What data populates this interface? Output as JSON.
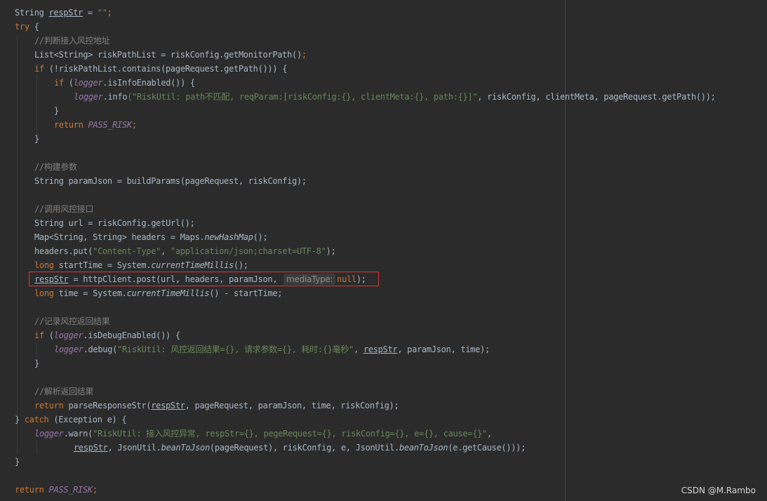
{
  "code": {
    "l1_type": "String",
    "l1_var": "respStr",
    "l1_assign": " = ",
    "l1_val": "\"\"",
    "l2_try": "try",
    "l2_brace": " {",
    "l3_comment": "//判断接入风控地址",
    "l4_a": "List",
    "l4_b": "<String>",
    "l4_c": " riskPathList = riskConfig.getMonitorPath",
    "l4_d": "()",
    "l5_if": "if",
    "l5_a": " (!riskPathList.contains",
    "l5_b": "(",
    "l5_c": "pageRequest.getPath",
    "l5_d": "()))",
    "l5_e": " {",
    "l6_if": "if",
    "l6_a": " (",
    "l6_logger": "logger",
    "l6_b": ".isInfoEnabled",
    "l6_c": "()) {",
    "l7_logger": "logger",
    "l7_a": ".info",
    "l7_str": "(\"RiskUtil: path不匹配, reqParam:[riskConfig:{}, clientMeta:{}, path:{}]\"",
    "l7_b": ", riskConfig, clientMeta, pageRequest.getPath",
    "l7_c": "());",
    "l8_close": "}",
    "l9_return": "return",
    "l9_const": "PASS_RISK",
    "l10_close": "}",
    "l12_comment": "//构建参数",
    "l13": "String paramJson = buildParams(pageRequest, riskConfig);",
    "l15_comment": "//调用风控接口",
    "l16": "String url = riskConfig.getUrl();",
    "l17_a": "Map",
    "l17_b": "<String, String>",
    "l17_c": " headers = Maps.",
    "l17_d": "newHashMap",
    "l17_e": "();",
    "l18_a": "headers.put(",
    "l18_s1": "\"Content-Type\"",
    "l18_b": ", ",
    "l18_s2": "\"application/json;charset=UTF-8\"",
    "l18_c": ");",
    "l19_long": "long",
    "l19_a": " startTime = System.",
    "l19_b": "currentTimeMillis",
    "l19_c": "();",
    "l20_var": "respStr",
    "l20_a": " = httpClient.post(url, headers, paramJson, ",
    "l20_hint": "mediaType:",
    "l20_null": "null",
    "l20_b": ");",
    "l21_long": "long",
    "l21_a": " time = System.",
    "l21_b": "currentTimeMillis",
    "l21_c": "() - startTime;",
    "l23_comment": "//记录风控返回结果",
    "l24_if": "if",
    "l24_a": " (",
    "l24_logger": "logger",
    "l24_b": ".isDebugEnabled",
    "l24_c": "()) {",
    "l25_logger": "logger",
    "l25_a": ".debug(",
    "l25_str": "\"RiskUtil: 风控返回结果={}, 请求参数={}, 耗时:{}毫秒\"",
    "l25_b": ", ",
    "l25_var": "respStr",
    "l25_c": ", paramJson, time);",
    "l26_close": "}",
    "l28_comment": "//解析返回结果",
    "l29_return": "return",
    "l29_a": " parseResponseStr(",
    "l29_var": "respStr",
    "l29_b": ", pageRequest, paramJson, time, riskConfig);",
    "l30_a": "} ",
    "l30_catch": "catch",
    "l30_b": " (Exception e) {",
    "l31_logger": "logger",
    "l31_a": ".warn(",
    "l31_str": "\"RiskUtil: 接入风控异常, respStr={}, pegeRequest={}, riskConfig={}, e={}, cause={}\"",
    "l31_b": ",",
    "l32_var": "respStr",
    "l32_a": ", JsonUtil.",
    "l32_b": "beanToJson",
    "l32_c": "(pageRequest), riskConfig, e, JsonUtil.",
    "l32_d": "beanToJson",
    "l32_e": "(e.getCause()));",
    "l33_close": "}",
    "l35_return": "return",
    "l35_const": "PASS_RISK",
    "l35_semi": ";"
  },
  "watermark": "CSDN @M.Rambo"
}
